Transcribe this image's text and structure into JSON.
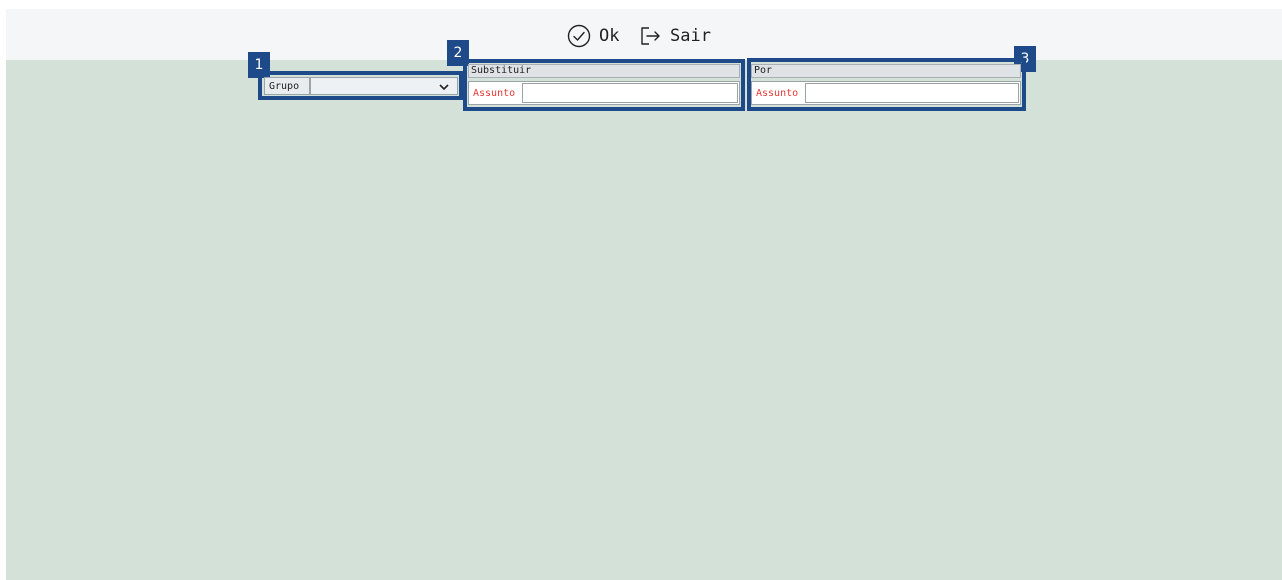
{
  "toolbar": {
    "ok_label": "Ok",
    "exit_label": "Sair"
  },
  "callouts": [
    {
      "number": "1"
    },
    {
      "number": "2"
    },
    {
      "number": "3"
    }
  ],
  "group_field": {
    "label": "Grupo",
    "selected_value": ""
  },
  "replace_section": {
    "title": "Substituir",
    "field_label": "Assunto",
    "value": ""
  },
  "by_section": {
    "title": "Por",
    "field_label": "Assunto",
    "value": ""
  },
  "colors": {
    "background": "#d4e1d9",
    "toolbar": "#f4f6f8",
    "callout": "#1e4a8a",
    "required_label": "#e53935"
  }
}
